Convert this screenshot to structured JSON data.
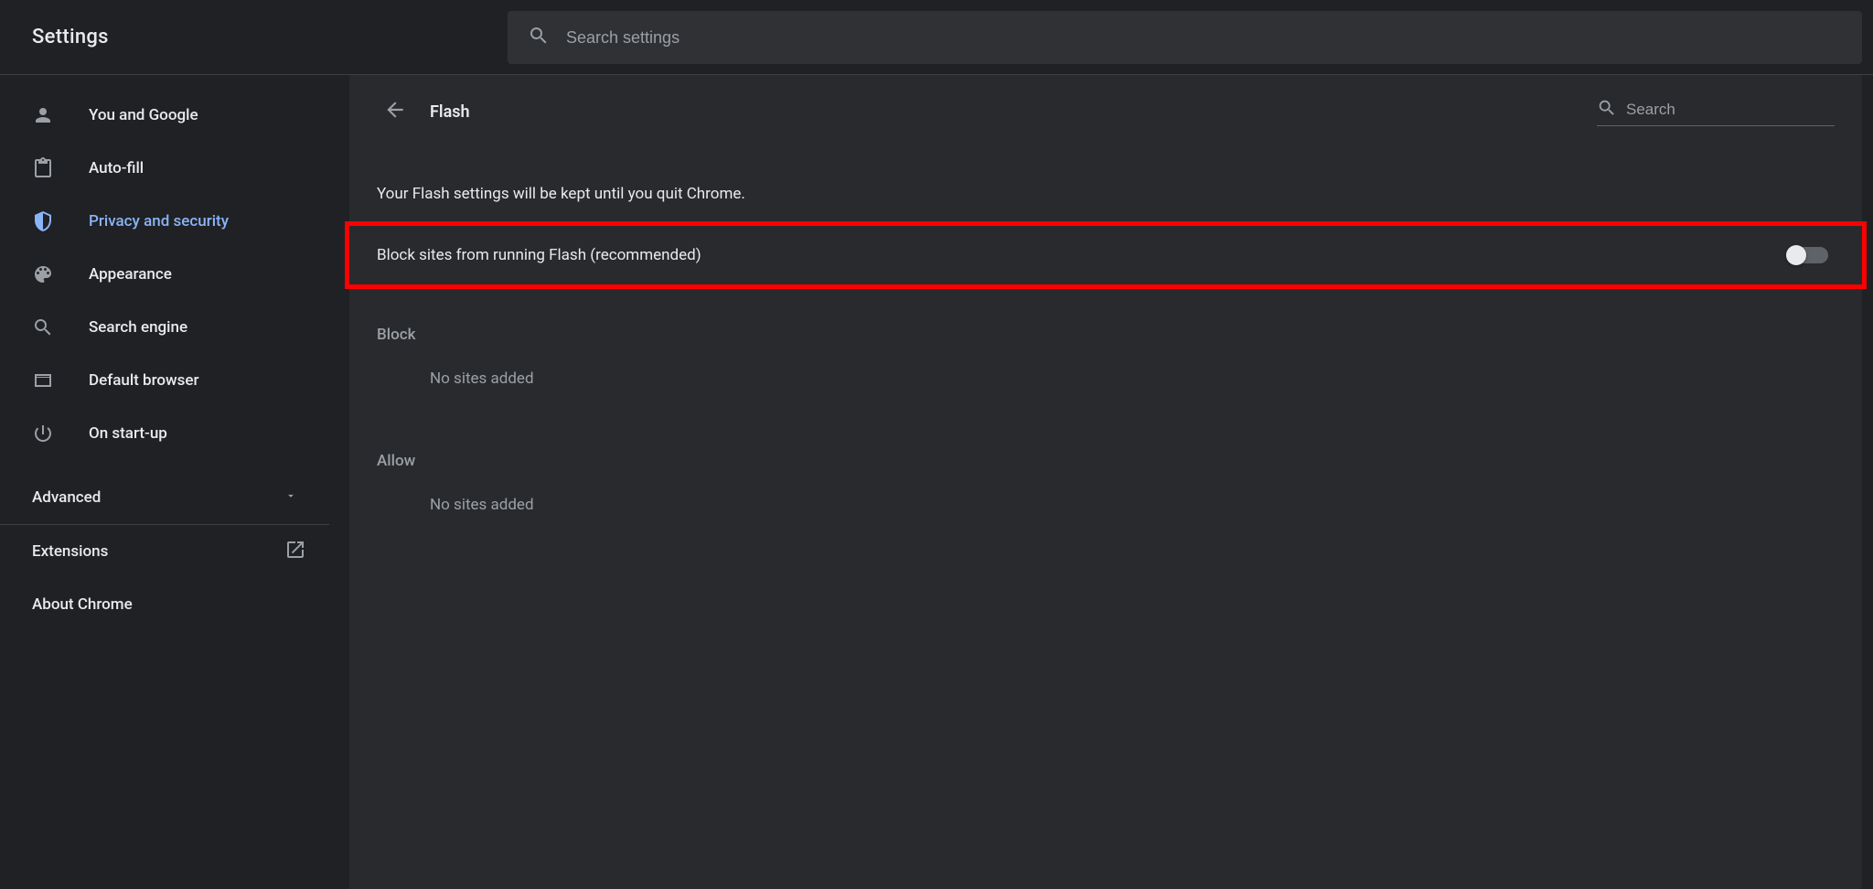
{
  "header": {
    "title": "Settings",
    "search_placeholder": "Search settings"
  },
  "sidebar": {
    "items": [
      {
        "label": "You and Google"
      },
      {
        "label": "Auto-fill"
      },
      {
        "label": "Privacy and security"
      },
      {
        "label": "Appearance"
      },
      {
        "label": "Search engine"
      },
      {
        "label": "Default browser"
      },
      {
        "label": "On start-up"
      }
    ],
    "advanced_label": "Advanced",
    "extensions_label": "Extensions",
    "about_label": "About Chrome"
  },
  "main": {
    "page_title": "Flash",
    "search_placeholder": "Search",
    "info_text": "Your Flash settings will be kept until you quit Chrome.",
    "block_toggle_label": "Block sites from running Flash (recommended)",
    "block_section": "Block",
    "block_empty": "No sites added",
    "allow_section": "Allow",
    "allow_empty": "No sites added"
  }
}
